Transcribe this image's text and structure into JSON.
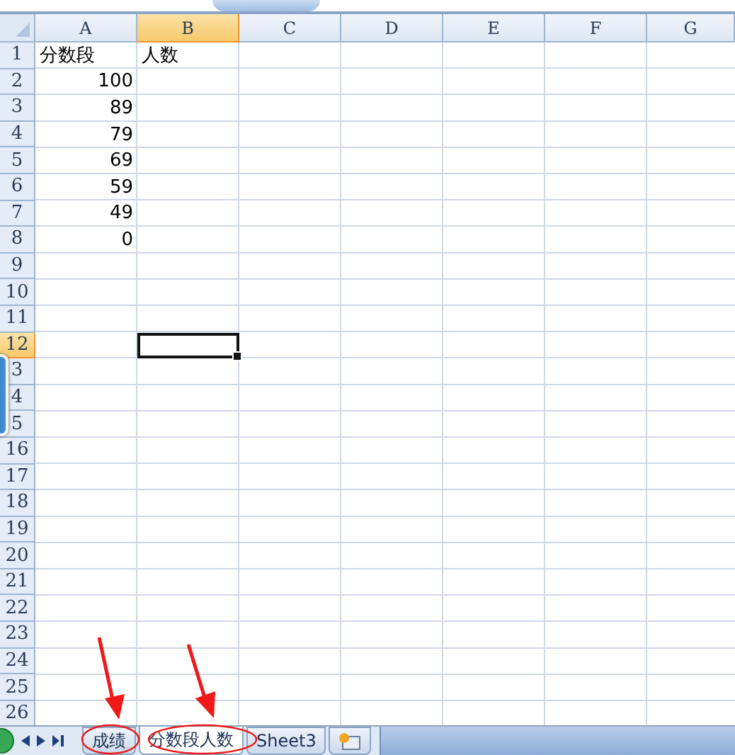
{
  "columns": [
    {
      "label": "A",
      "selected": false
    },
    {
      "label": "B",
      "selected": true
    },
    {
      "label": "C",
      "selected": false
    },
    {
      "label": "D",
      "selected": false
    },
    {
      "label": "E",
      "selected": false
    },
    {
      "label": "F",
      "selected": false
    },
    {
      "label": "G",
      "selected": false
    }
  ],
  "rows": [
    {
      "number": "1",
      "selected": false,
      "cells": [
        {
          "text": "分数段",
          "kind": "text"
        },
        {
          "text": "人数",
          "kind": "text"
        }
      ]
    },
    {
      "number": "2",
      "selected": false,
      "cells": [
        {
          "text": "100",
          "kind": "number"
        }
      ]
    },
    {
      "number": "3",
      "selected": false,
      "cells": [
        {
          "text": "89",
          "kind": "number"
        }
      ]
    },
    {
      "number": "4",
      "selected": false,
      "cells": [
        {
          "text": "79",
          "kind": "number"
        }
      ]
    },
    {
      "number": "5",
      "selected": false,
      "cells": [
        {
          "text": "69",
          "kind": "number"
        }
      ]
    },
    {
      "number": "6",
      "selected": false,
      "cells": [
        {
          "text": "59",
          "kind": "number"
        }
      ]
    },
    {
      "number": "7",
      "selected": false,
      "cells": [
        {
          "text": "49",
          "kind": "number"
        }
      ]
    },
    {
      "number": "8",
      "selected": false,
      "cells": [
        {
          "text": "0",
          "kind": "number"
        }
      ]
    },
    {
      "number": "9",
      "selected": false
    },
    {
      "number": "10",
      "selected": false
    },
    {
      "number": "11",
      "selected": false
    },
    {
      "number": "12",
      "selected": true
    },
    {
      "number": "3",
      "selected": false
    },
    {
      "number": "4",
      "selected": false
    },
    {
      "number": "5",
      "selected": false
    },
    {
      "number": "16",
      "selected": false
    },
    {
      "number": "17",
      "selected": false
    },
    {
      "number": "18",
      "selected": false
    },
    {
      "number": "19",
      "selected": false
    },
    {
      "number": "20",
      "selected": false
    },
    {
      "number": "21",
      "selected": false
    },
    {
      "number": "22",
      "selected": false
    },
    {
      "number": "23",
      "selected": false
    },
    {
      "number": "24",
      "selected": false
    },
    {
      "number": "25",
      "selected": false
    },
    {
      "number": "26",
      "selected": false
    }
  ],
  "sheet_tabs": [
    {
      "label": "成绩",
      "selected": false
    },
    {
      "label": "分数段人数",
      "selected": true
    },
    {
      "label": "Sheet3",
      "selected": false
    }
  ]
}
